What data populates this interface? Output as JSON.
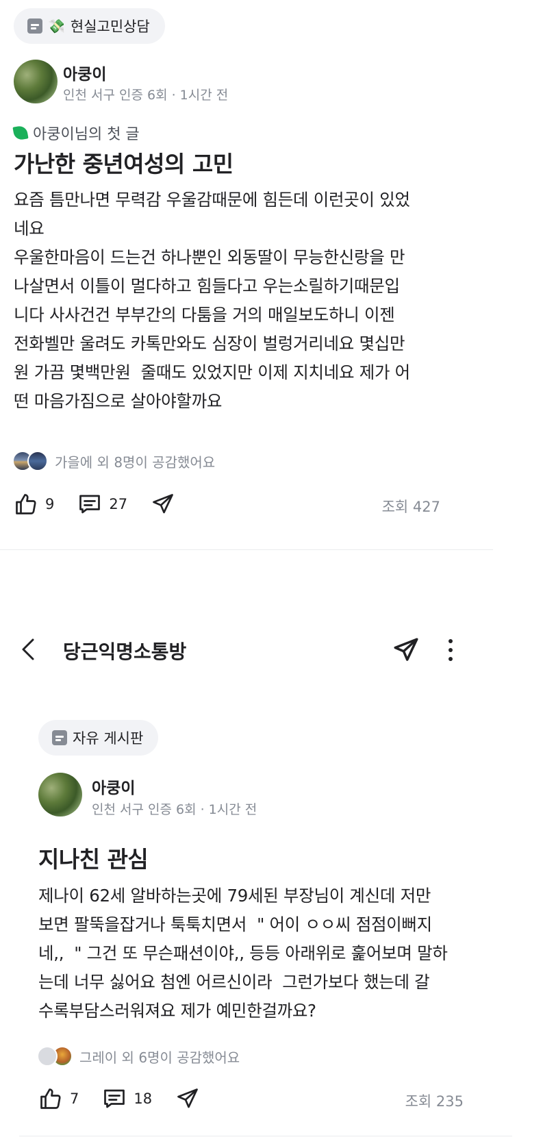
{
  "post1": {
    "category": "현실고민상담",
    "category_icon": "money-emoji",
    "author": "아쿵이",
    "meta": "인천 서구 인증 6회 · 1시간 전",
    "first_post_badge": "아쿵이님의 첫 글",
    "title": "가난한 중년여성의 고민",
    "body_lines": [
      "요즘 틈만나면 무력감 우울감때문에 힘든데 이런곳이 있었",
      "네요",
      "우울한마음이 드는건 하나뿐인 외동딸이 무능한신랑을 만",
      "나살면서 이틀이 멀다하고 힘들다고 우는소릴하기때문입",
      "니다 사사건건 부부간의 다툼을 거의 매일보도하니 이젠",
      "전화벨만 울려도 카톡만와도 심장이 벌렁거리네요 몇십만",
      "원 가끔 몇백만원  줄때도 있었지만 이제 지치네요 제가 어",
      "떤 마음가짐으로 살아야할까요"
    ],
    "empathy": "가을에 외 8명이 공감했어요",
    "likes": "9",
    "comments": "27",
    "views": "조회 427"
  },
  "post2": {
    "topbar_title": "당근익명소통방",
    "category": "자유 게시판",
    "author": "아쿵이",
    "meta": "인천 서구 인증 6회 · 1시간 전",
    "title": "지나친 관심",
    "body_lines": [
      "제나이 62세 알바하는곳에 79세된 부장님이 계신데 저만",
      "보면 팔뚝을잡거나 툭툭치면서  \" 어이 ㅇㅇ씨 점점이뻐지",
      "네,,  \" 그건 또 무슨패션이야,, 등등 아래위로 훑어보며 말하",
      "는데 너무 싫어요 첨엔 어르신이라  그런가보다 했는데 갈",
      "수록부담스러워져요 제가 예민한걸까요?"
    ],
    "empathy": "그레이 외 6명이 공감했어요",
    "likes": "7",
    "comments": "18",
    "views": "조회 235"
  },
  "colors": {
    "accent_green": "#1bb05a",
    "muted": "#868b94",
    "text": "#212124"
  },
  "icons": [
    "document-icon",
    "leaf-icon",
    "thumbs-up-icon",
    "comment-icon",
    "share-icon",
    "back-arrow-icon",
    "more-vertical-icon"
  ]
}
